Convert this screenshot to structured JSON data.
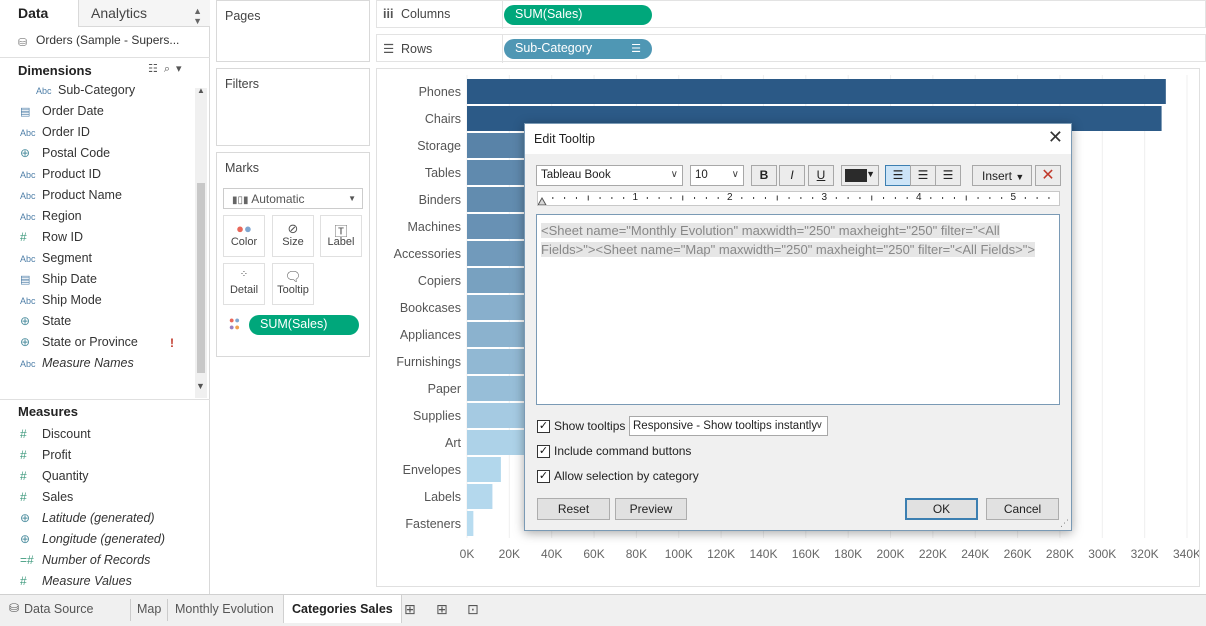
{
  "data_pane": {
    "tab_data": "Data",
    "tab_analytics": "Analytics",
    "datasource": "Orders (Sample - Supers...",
    "dimensions_title": "Dimensions",
    "dimensions": [
      {
        "label": "Sub-Category",
        "icon": "Abc"
      },
      {
        "label": "Order Date",
        "icon": "calendar-icon"
      },
      {
        "label": "Order ID",
        "icon": "Abc"
      },
      {
        "label": "Postal Code",
        "icon": "globe-icon"
      },
      {
        "label": "Product ID",
        "icon": "Abc"
      },
      {
        "label": "Product Name",
        "icon": "Abc"
      },
      {
        "label": "Region",
        "icon": "Abc"
      },
      {
        "label": "Row ID",
        "icon": "#"
      },
      {
        "label": "Segment",
        "icon": "Abc"
      },
      {
        "label": "Ship Date",
        "icon": "calendar-icon"
      },
      {
        "label": "Ship Mode",
        "icon": "Abc"
      },
      {
        "label": "State",
        "icon": "globe-icon"
      },
      {
        "label": "State or Province",
        "icon": "globe-icon"
      },
      {
        "label": "Measure Names",
        "icon": "Abc"
      }
    ],
    "warning_mark": "!",
    "measures_title": "Measures",
    "measures": [
      {
        "label": "Discount",
        "icon": "#"
      },
      {
        "label": "Profit",
        "icon": "#"
      },
      {
        "label": "Quantity",
        "icon": "#"
      },
      {
        "label": "Sales",
        "icon": "#"
      },
      {
        "label": "Latitude (generated)",
        "icon": "globe-icon"
      },
      {
        "label": "Longitude (generated)",
        "icon": "globe-icon"
      },
      {
        "label": "Number of Records",
        "icon": "=#"
      },
      {
        "label": "Measure Values",
        "icon": "#"
      }
    ]
  },
  "cards": {
    "pages": "Pages",
    "filters": "Filters",
    "marks": "Marks",
    "mark_type": "Automatic",
    "buttons": {
      "color": "Color",
      "size": "Size",
      "label": "Label",
      "detail": "Detail",
      "tooltip": "Tooltip"
    },
    "marks_pill": "SUM(Sales)"
  },
  "shelves": {
    "columns_label": "Columns",
    "columns_pill": "SUM(Sales)",
    "rows_label": "Rows",
    "rows_pill": "Sub-Category"
  },
  "chart_data": {
    "type": "bar",
    "orientation": "horizontal",
    "categories": [
      "Phones",
      "Chairs",
      "Storage",
      "Tables",
      "Binders",
      "Machines",
      "Accessories",
      "Copiers",
      "Bookcases",
      "Appliances",
      "Furnishings",
      "Paper",
      "Supplies",
      "Art",
      "Envelopes",
      "Labels",
      "Fasteners"
    ],
    "values": [
      330000,
      328000,
      224000,
      207000,
      203000,
      189000,
      167000,
      150000,
      115000,
      108000,
      92000,
      78000,
      47000,
      27000,
      16000,
      12000,
      3000
    ],
    "xticks": [
      "0K",
      "20K",
      "40K",
      "60K",
      "80K",
      "100K",
      "120K",
      "140K",
      "160K",
      "180K",
      "200K",
      "220K",
      "240K",
      "260K",
      "280K",
      "300K",
      "320K",
      "340K"
    ],
    "xlim": [
      0,
      340000
    ],
    "grid": true,
    "colors": {
      "high": "#2b5986",
      "low": "#b9ddf1"
    }
  },
  "dialog": {
    "title": "Edit Tooltip",
    "font": "Tableau Book",
    "size": "10",
    "bold": "B",
    "italic": "I",
    "underline": "U",
    "color": "#2b2b2b",
    "insert": "Insert",
    "ruler_numbers": [
      "1",
      "2",
      "3",
      "4",
      "5"
    ],
    "content": "<Sheet name=\"Monthly Evolution\" maxwidth=\"250\" maxheight=\"250\" filter=\"<All Fields>\"><Sheet name=\"Map\" maxwidth=\"250\" maxheight=\"250\" filter=\"<All Fields>\">",
    "show_tooltips": "Show tooltips",
    "tooltip_mode": "Responsive - Show tooltips instantly",
    "include_command_buttons": "Include command buttons",
    "allow_selection": "Allow selection by category",
    "reset": "Reset",
    "preview": "Preview",
    "ok": "OK",
    "cancel": "Cancel"
  },
  "bottom_tabs": {
    "data_source": "Data Source",
    "sheets": [
      "Map",
      "Monthly Evolution",
      "Categories Sales"
    ]
  }
}
